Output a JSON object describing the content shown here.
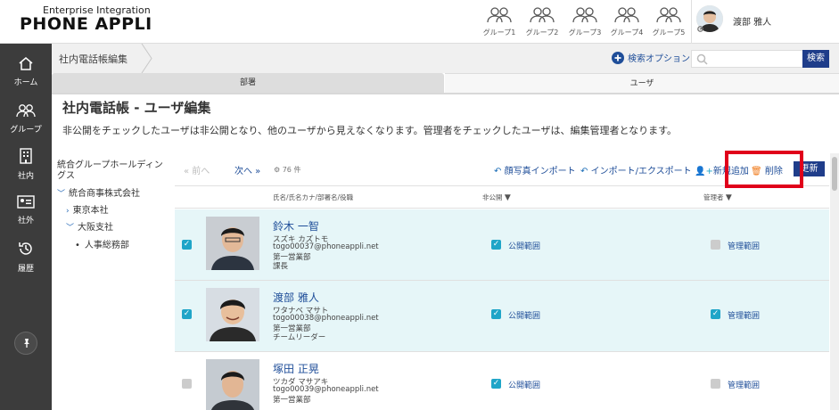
{
  "header": {
    "logo_top": "Enterprise Integration",
    "logo_main": "PHONE APPLI",
    "groups": [
      "グループ1",
      "グループ2",
      "グループ3",
      "グループ4",
      "グループ5"
    ],
    "user_name": "渡部 雅人"
  },
  "sidebar": {
    "items": [
      {
        "label": "ホーム",
        "icon": "home-icon"
      },
      {
        "label": "グループ",
        "icon": "group-icon"
      },
      {
        "label": "社内",
        "icon": "building-icon"
      },
      {
        "label": "社外",
        "icon": "id-card-icon"
      },
      {
        "label": "履歴",
        "icon": "history-icon"
      }
    ],
    "pin_icon": "pin-icon"
  },
  "breadcrumb": {
    "current": "社内電話帳編集"
  },
  "search": {
    "options_label": "検索オプション",
    "placeholder": "",
    "button_label": "検索"
  },
  "tabs": [
    {
      "label": "部署"
    },
    {
      "label": "ユーザ"
    }
  ],
  "page": {
    "title": "社内電話帳 - ユーザ編集",
    "description": "非公開をチェックしたユーザは非公開となり、他のユーザから見えなくなります。管理者をチェックしたユーザは、編集管理者となります。"
  },
  "tree": {
    "root": "統合グループホールディングス",
    "nodes": [
      {
        "label": "統合商事株式会社",
        "expander": "﹀"
      },
      {
        "label": "東京本社",
        "expander": "›"
      },
      {
        "label": "大阪支社",
        "expander": "﹀"
      },
      {
        "label": "人事総務部",
        "expander": "•"
      }
    ]
  },
  "toolbar": {
    "prev": "« 前へ",
    "next": "次へ »",
    "count": "76 件",
    "photo_import": "顔写真インポート",
    "import_export": "インポート/エクスポート",
    "add": "新規追加",
    "delete": "削除",
    "update": "更新"
  },
  "columns": {
    "name": "氏名/氏名カナ/部署名/役職",
    "private": "非公開",
    "admin": "管理者"
  },
  "rows": [
    {
      "name": "鈴木 一智",
      "kana": "スズキ カズトモ",
      "email": "togo00037@phoneappli.net",
      "dept": "第一営業部",
      "title": "課長",
      "selected": true,
      "private": true,
      "private_label": "公開範囲",
      "admin": false,
      "admin_label": "管理範囲"
    },
    {
      "name": "渡部 雅人",
      "kana": "ワタナベ マサト",
      "email": "togo00038@phoneappli.net",
      "dept": "第一営業部",
      "title": "チームリーダー",
      "selected": true,
      "private": true,
      "private_label": "公開範囲",
      "admin": true,
      "admin_label": "管理範囲"
    },
    {
      "name": "塚田 正晃",
      "kana": "ツカダ マサアキ",
      "email": "togo00039@phoneappli.net",
      "dept": "第一営業部",
      "title": "",
      "selected": false,
      "private": true,
      "private_label": "公開範囲",
      "admin": false,
      "admin_label": "管理範囲"
    }
  ],
  "colors": {
    "accent": "#1f4e99",
    "highlight": "#e0001a",
    "sidebar": "#3c3c3c",
    "check": "#1fa5c8"
  }
}
